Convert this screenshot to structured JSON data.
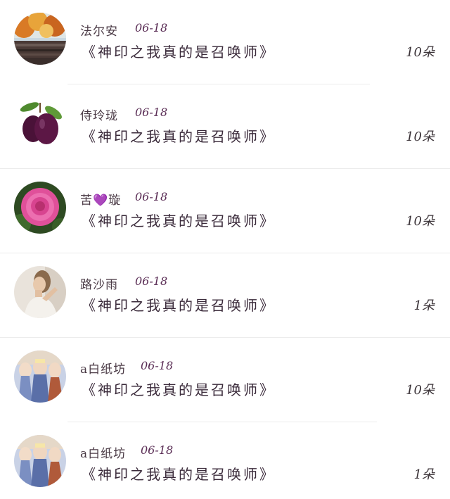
{
  "rows": [
    {
      "name": "法尔安",
      "date": "06-18",
      "title": "《神印之我真的是召唤师》",
      "gift": "10朵",
      "avatar": "autumn-trees-avatar"
    },
    {
      "name": "侍玲珑",
      "date": "06-18",
      "title": "《神印之我真的是召唤师》",
      "gift": "10朵",
      "avatar": "plum-avatar"
    },
    {
      "name": "苦💜璇",
      "date": "06-18",
      "title": "《神印之我真的是召唤师》",
      "gift": "10朵",
      "avatar": "pink-rose-avatar"
    },
    {
      "name": "路沙雨",
      "date": "06-18",
      "title": "《神印之我真的是召唤师》",
      "gift": "1朵",
      "avatar": "woman-portrait-avatar"
    },
    {
      "name": "a白纸坊",
      "date": "06-18",
      "title": "《神印之我真的是召唤师》",
      "gift": "10朵",
      "avatar": "anime-characters-avatar"
    },
    {
      "name": "a白纸坊",
      "date": "06-18",
      "title": "《神印之我真的是召唤师》",
      "gift": "1朵",
      "avatar": "anime-characters-avatar"
    }
  ]
}
